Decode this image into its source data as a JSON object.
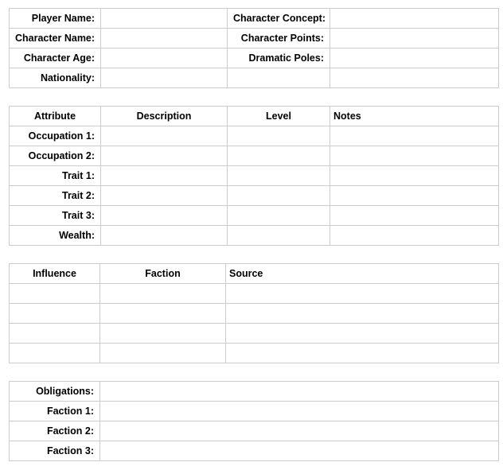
{
  "info": {
    "left_labels": [
      "Player Name:",
      "Character Name:",
      "Character Age:",
      "Nationality:"
    ],
    "right_labels": [
      "Character Concept:",
      "Character Points:",
      "Dramatic Poles:",
      ""
    ]
  },
  "attributes": {
    "headers": [
      "Attribute",
      "Description",
      "Level",
      "Notes"
    ],
    "rows": [
      "Occupation 1:",
      "Occupation 2:",
      "Trait 1:",
      "Trait 2:",
      "Trait 3:",
      "Wealth:"
    ]
  },
  "influence": {
    "headers": [
      "Influence",
      "Faction",
      "Source"
    ],
    "row_count": 4
  },
  "obligations": {
    "rows": [
      "Obligations:",
      "Faction 1:",
      "Faction 2:",
      "Faction 3:"
    ]
  }
}
